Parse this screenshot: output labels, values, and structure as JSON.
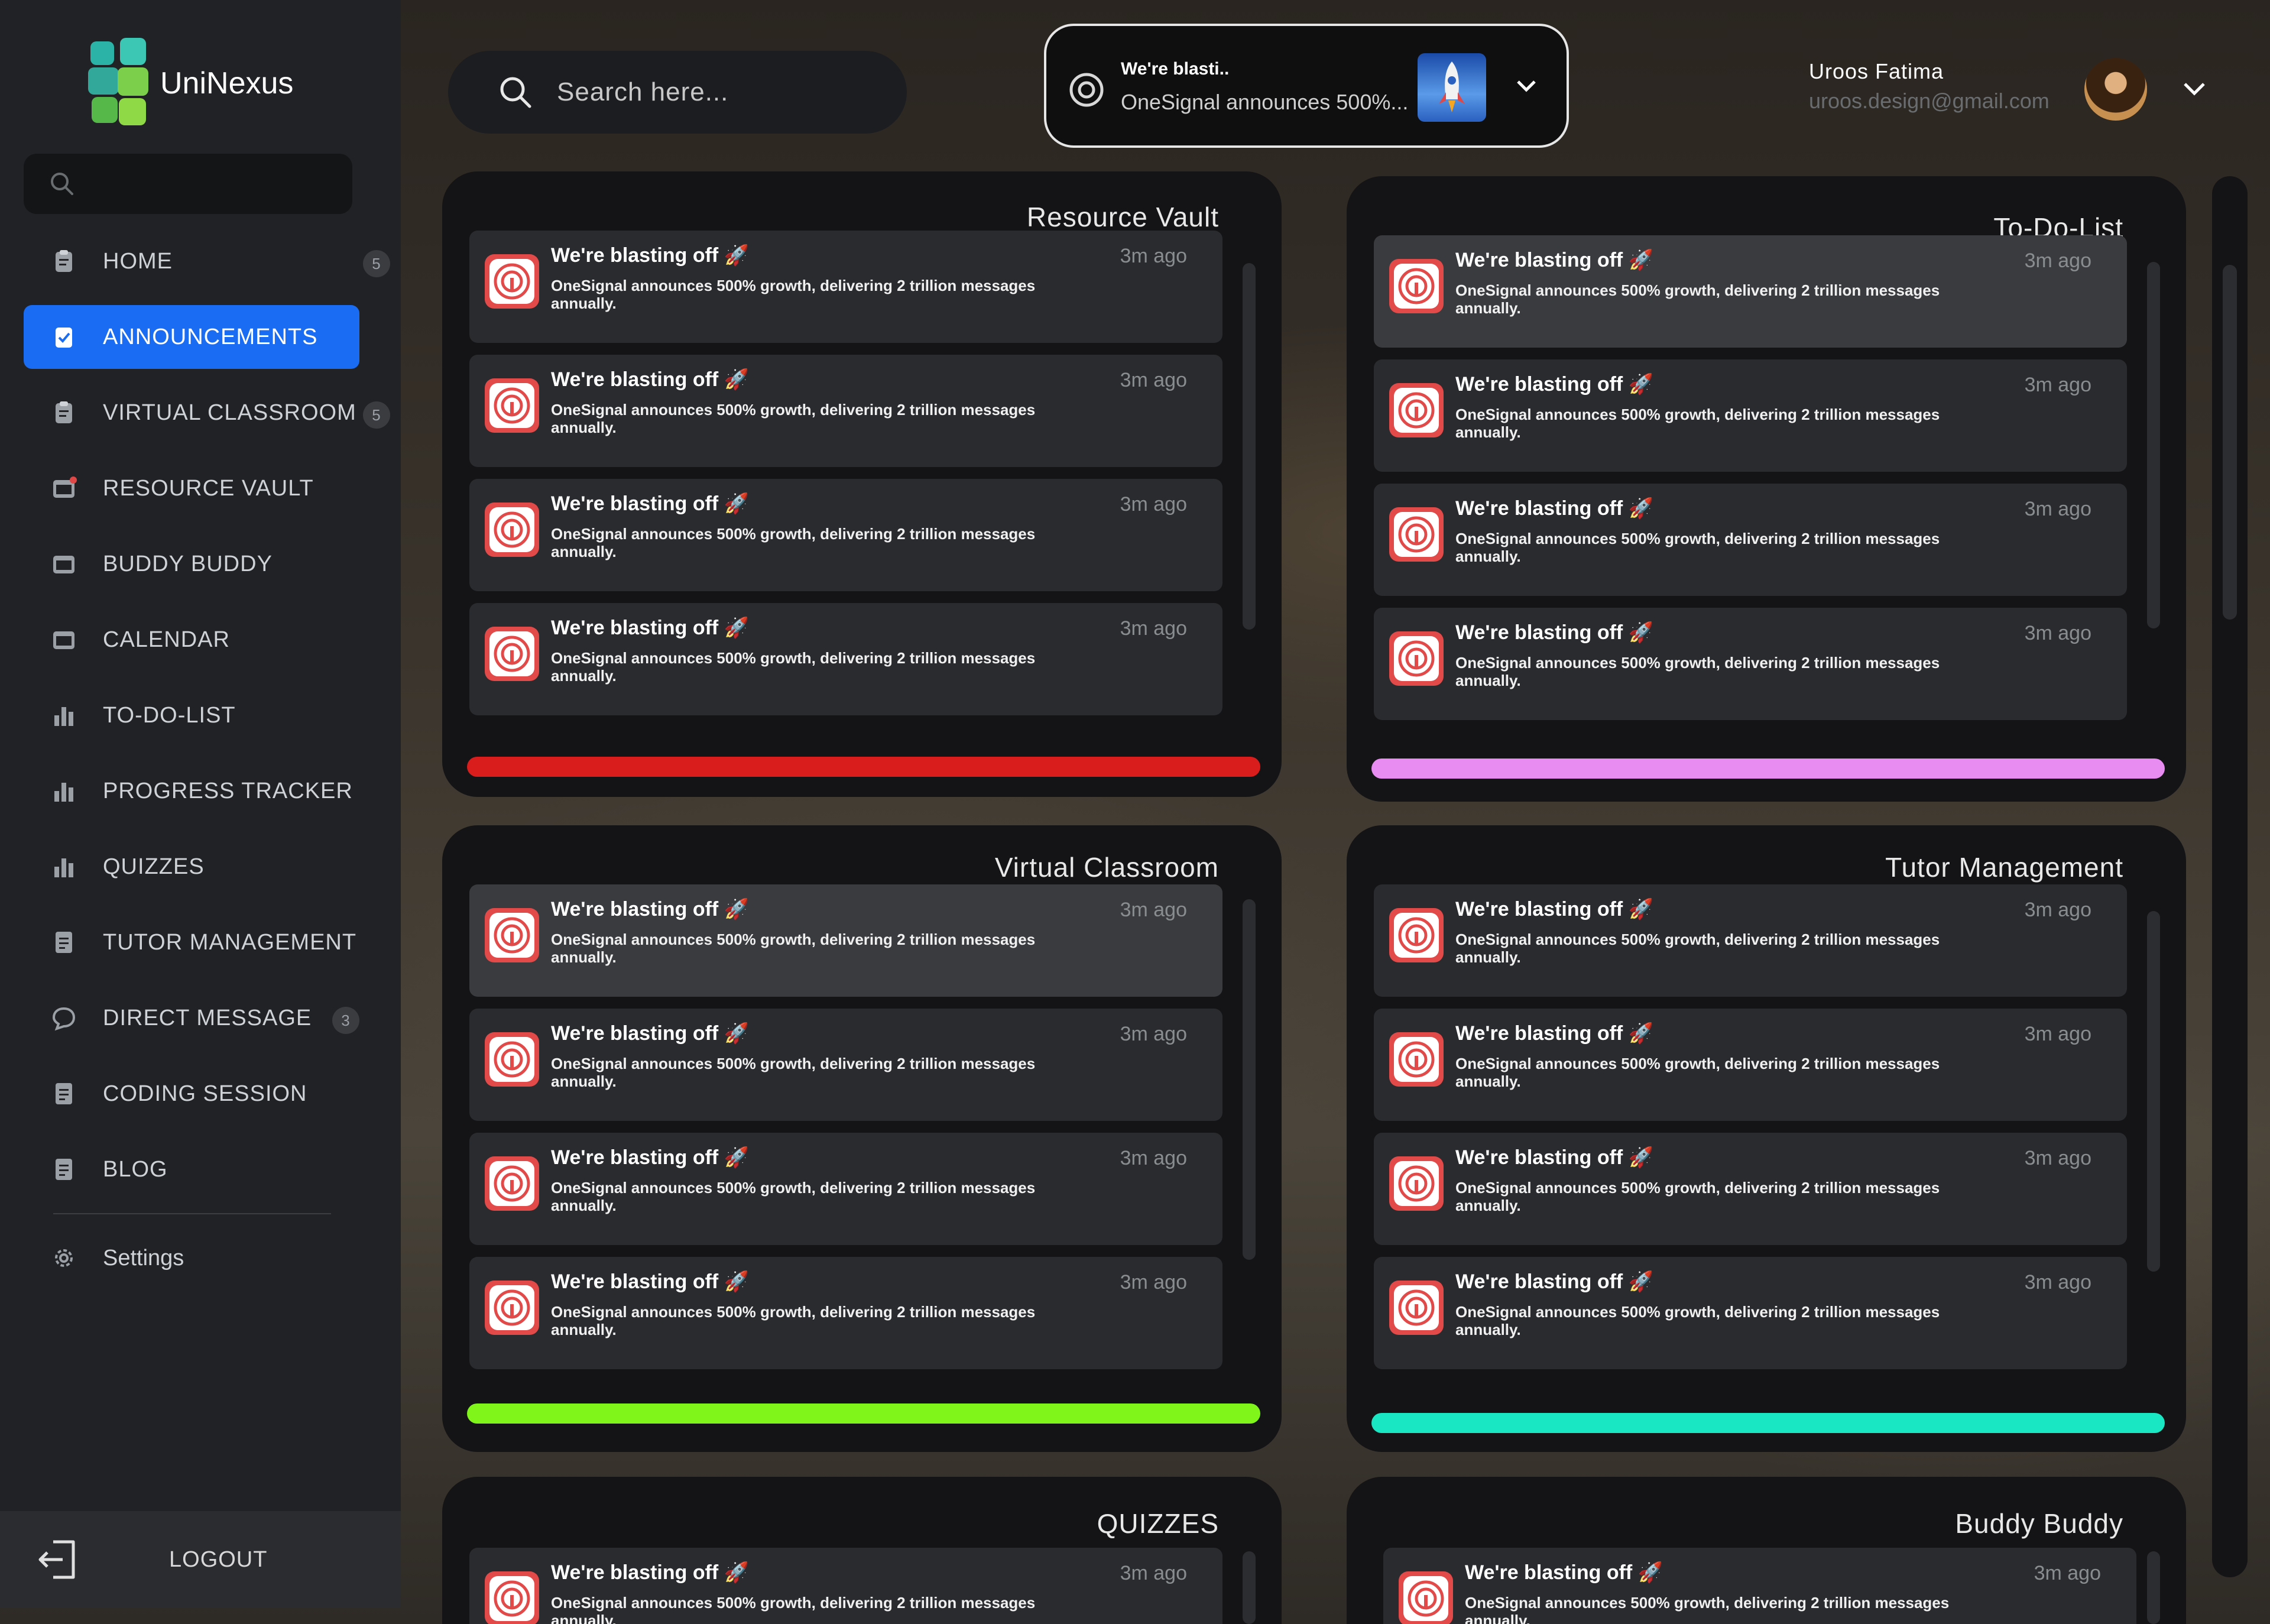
{
  "app": {
    "name": "UniNexus"
  },
  "sidebar": {
    "search_placeholder": "",
    "items": [
      {
        "label": "HOME",
        "icon": "clipboard-icon",
        "badge": "5",
        "active": false
      },
      {
        "label": "ANNOUNCEMENTS",
        "icon": "clipboard-check-icon",
        "badge": "",
        "active": true
      },
      {
        "label": "VIRTUAL CLASSROOM",
        "icon": "clipboard-icon",
        "badge": "5",
        "active": false
      },
      {
        "label": "RESOURCE VAULT",
        "icon": "window-dot-icon",
        "badge": "",
        "active": false
      },
      {
        "label": "BUDDY BUDDY",
        "icon": "window-icon",
        "badge": "",
        "active": false
      },
      {
        "label": "CALENDAR",
        "icon": "window-icon",
        "badge": "",
        "active": false
      },
      {
        "label": "TO-DO-LIST",
        "icon": "bar-chart-icon",
        "badge": "",
        "active": false
      },
      {
        "label": "PROGRESS TRACKER",
        "icon": "bar-chart-icon",
        "badge": "",
        "active": false
      },
      {
        "label": "QUIZZES",
        "icon": "bar-chart-icon",
        "badge": "",
        "active": false
      },
      {
        "label": "TUTOR MANAGEMENT",
        "icon": "document-icon",
        "badge": "",
        "active": false
      },
      {
        "label": "DIRECT MESSAGE",
        "icon": "chat-bubble-icon",
        "badge": "3",
        "active": false
      },
      {
        "label": "CODING SESSION",
        "icon": "document-icon",
        "badge": "",
        "active": false
      },
      {
        "label": "BLOG",
        "icon": "document-icon",
        "badge": "",
        "active": false
      }
    ],
    "settings_label": "Settings",
    "logout_label": "LOGOUT"
  },
  "header": {
    "search_placeholder": "Search here...",
    "notification": {
      "title": "We're blasti..",
      "body": "OneSignal announces 500%..."
    },
    "user": {
      "name": "Uroos Fatima",
      "email": "uroos.design@gmail.com"
    }
  },
  "notification_item": {
    "title": "We're blasting off 🚀",
    "body": "OneSignal announces 500% growth, delivering 2 trillion messages annually.",
    "time": "3m ago"
  },
  "cards": [
    {
      "title": "Resource Vault",
      "bar_color": "#d91c1c"
    },
    {
      "title": "To-Do-List",
      "bar_color": "#e98cf2"
    },
    {
      "title": "Virtual Classroom",
      "bar_color": "#7ff51a"
    },
    {
      "title": "Tutor Management",
      "bar_color": "#19e6c3"
    },
    {
      "title": "QUIZZES",
      "bar_color": ""
    },
    {
      "title": "Buddy Buddy",
      "bar_color": ""
    }
  ],
  "colors": {
    "accent": "#1a6cf2",
    "card_bg": "#141416",
    "item_bg": "#2a2b2e",
    "app_icon": "#e24a4a"
  }
}
